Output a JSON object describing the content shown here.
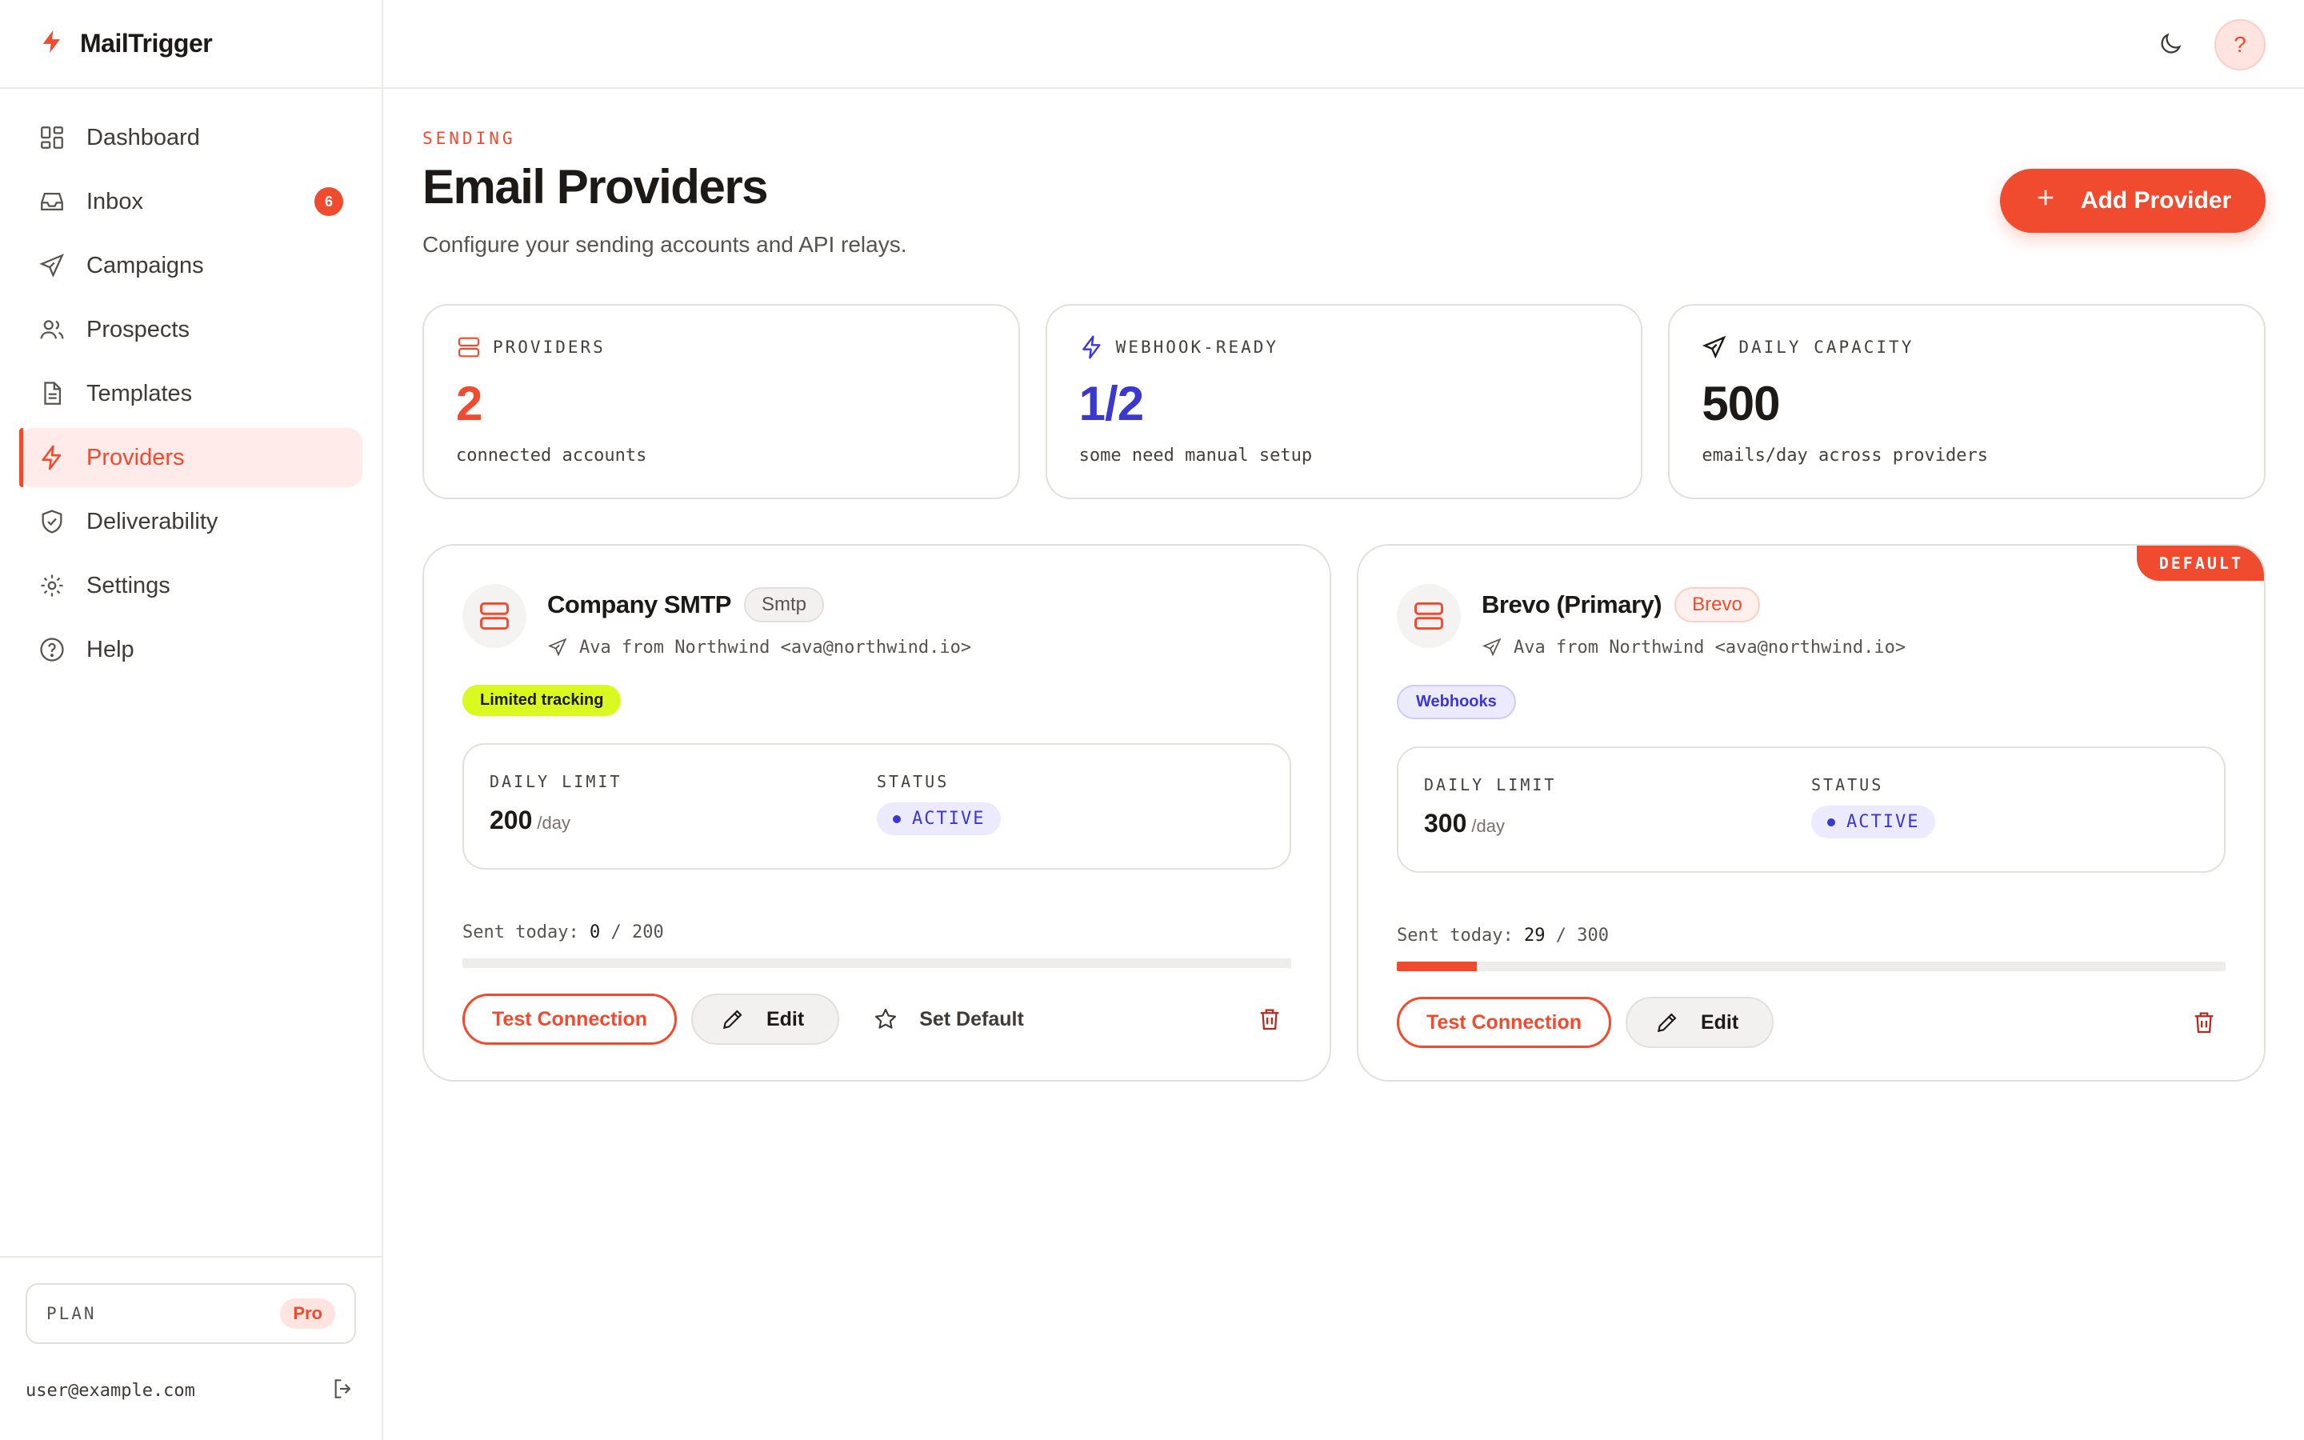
{
  "app": {
    "name": "MailTrigger",
    "accent": "#f04a2f"
  },
  "sidebar": {
    "items": [
      {
        "label": "Dashboard",
        "icon": "dashboard-icon"
      },
      {
        "label": "Inbox",
        "icon": "inbox-icon",
        "badge": "6"
      },
      {
        "label": "Campaigns",
        "icon": "send-icon"
      },
      {
        "label": "Prospects",
        "icon": "users-icon"
      },
      {
        "label": "Templates",
        "icon": "document-icon"
      },
      {
        "label": "Providers",
        "icon": "bolt-icon",
        "active": true
      },
      {
        "label": "Deliverability",
        "icon": "shield-icon"
      },
      {
        "label": "Settings",
        "icon": "gear-icon"
      },
      {
        "label": "Help",
        "icon": "help-circle-icon"
      }
    ],
    "plan": {
      "label": "PLAN",
      "value": "Pro"
    },
    "user_email": "user@example.com"
  },
  "topbar": {
    "help_label": "?"
  },
  "header": {
    "eyebrow": "SENDING",
    "title": "Email Providers",
    "subtitle": "Configure your sending accounts and API relays.",
    "add_button": "Add Provider"
  },
  "stats": [
    {
      "label": "PROVIDERS",
      "value": "2",
      "note": "connected accounts",
      "color": "#f04a2f"
    },
    {
      "label": "WEBHOOK-READY",
      "value": "1/2",
      "note": "some need manual setup",
      "color": "#3b37d1"
    },
    {
      "label": "DAILY CAPACITY",
      "value": "500",
      "note": "emails/day across providers",
      "color": "#1c1917"
    }
  ],
  "providers": [
    {
      "name": "Company SMTP",
      "type": "Smtp",
      "from": "Ava from Northwind <ava@northwind.io>",
      "tag": "Limited tracking",
      "daily_limit_label": "DAILY LIMIT",
      "daily_limit": "200",
      "daily_unit": "/day",
      "status_label": "STATUS",
      "status": "ACTIVE",
      "sent_label": "Sent today:",
      "sent": "0",
      "limit": "200",
      "sent_fraction": 0.0,
      "test_label": "Test Connection",
      "edit_label": "Edit",
      "default_label": "Set Default"
    },
    {
      "name": "Brevo (Primary)",
      "type": "Brevo",
      "from": "Ava from Northwind <ava@northwind.io>",
      "tag": "Webhooks",
      "ribbon": "DEFAULT",
      "daily_limit_label": "DAILY LIMIT",
      "daily_limit": "300",
      "daily_unit": "/day",
      "status_label": "STATUS",
      "status": "ACTIVE",
      "sent_label": "Sent today:",
      "sent": "29",
      "limit": "300",
      "sent_fraction": 0.0967,
      "test_label": "Test Connection",
      "edit_label": "Edit"
    }
  ]
}
